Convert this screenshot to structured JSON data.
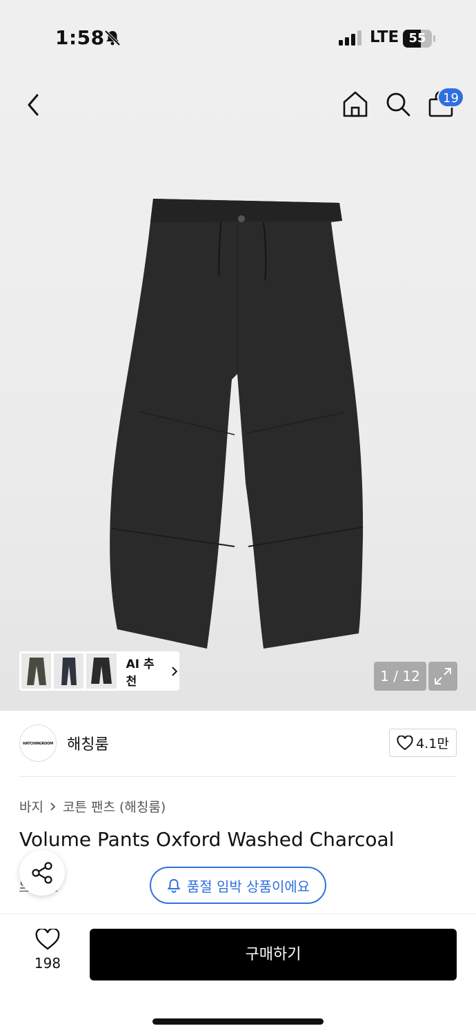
{
  "status_bar": {
    "time": "1:58",
    "network": "LTE",
    "battery": "55"
  },
  "header": {
    "cart_count": "19",
    "icons": [
      "back-icon",
      "home-icon",
      "search-icon",
      "shopping-bag-icon"
    ]
  },
  "gallery": {
    "ai_recommend_label": "AI 추천",
    "page_counter": "1 / 12",
    "expand_icon": "expand-icon"
  },
  "brand": {
    "logo_text": "HATCHINGROOM",
    "name": "해칭룸",
    "likes": "4.1만"
  },
  "breadcrumb": {
    "category": "바지",
    "subcategory": "코튼 팬츠 (해칭룸)"
  },
  "product": {
    "title": "Volume Pants Oxford Washed Charcoal",
    "partial_link": "의 상세",
    "soldout_notice": "품절 임박 상품이에요"
  },
  "bottom_bar": {
    "like_count": "198",
    "buy_label": "구매하기"
  },
  "colors": {
    "accent_blue": "#2f6fe0",
    "buy_button": "#000000",
    "hero_bg": "#efefef"
  }
}
